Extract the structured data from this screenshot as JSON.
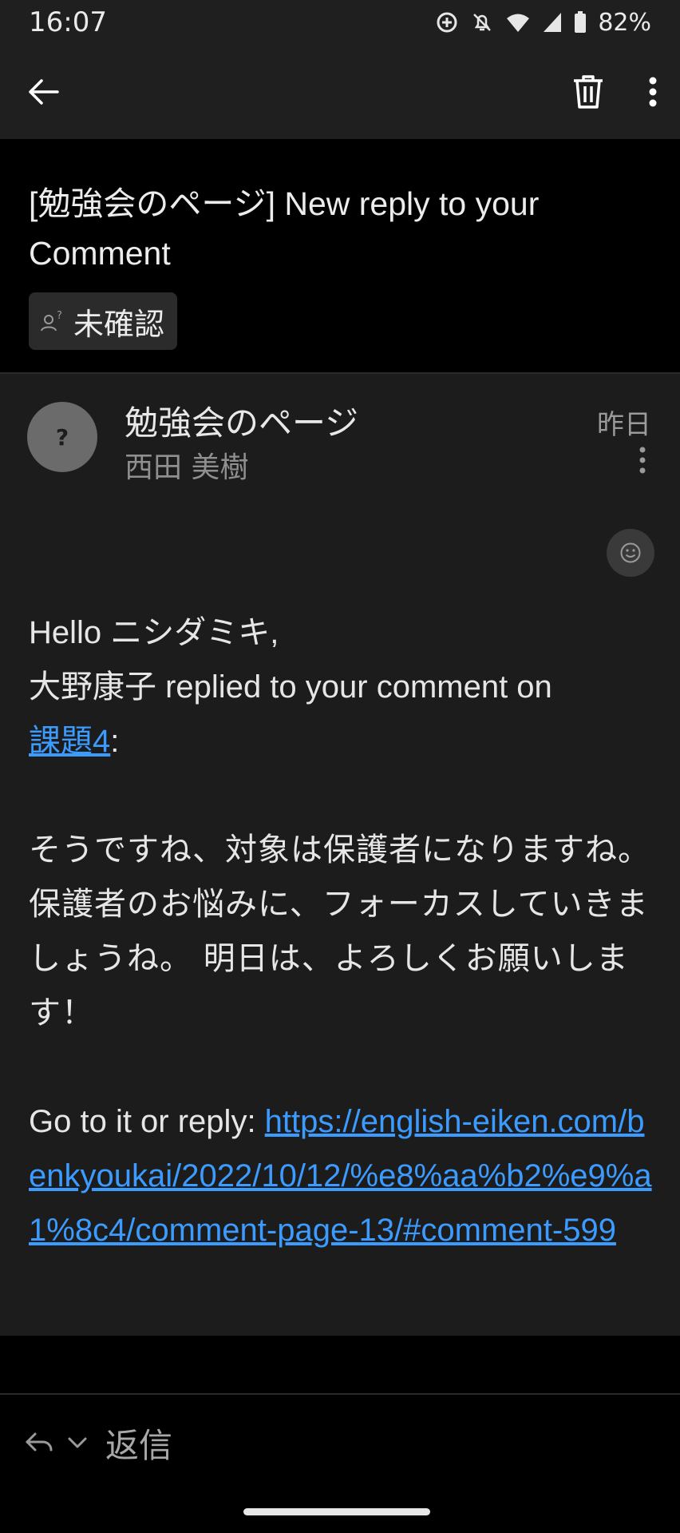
{
  "status_bar": {
    "time": "16:07",
    "battery_percent": "82%",
    "icons": [
      "data-saver-icon",
      "notifications-off-icon",
      "wifi-icon",
      "cell-signal-icon",
      "battery-icon"
    ]
  },
  "app_bar": {
    "back_icon": "arrow-left-icon",
    "delete_icon": "trash-icon",
    "more_icon": "more-vert-icon"
  },
  "email": {
    "subject": "[勉強会のページ] New reply to your Comment",
    "label": "未確認",
    "label_icon": "unknown-person-icon",
    "sender_name": "勉強会のページ",
    "recipient": "西田 美樹",
    "date": "昨日",
    "avatar_text": "?",
    "body": {
      "greeting": "Hello ニシダミキ,",
      "replied_line": "大野康子 replied to your comment on",
      "post_link": "課題4",
      "post_suffix": ":",
      "comment_text": "そうですね、対象は保護者になりますね。保護者のお悩みに、フォーカスしていきましょうね。 明日は、よろしくお願いします！",
      "goto_prefix": "Go to it or reply: ",
      "goto_link": "https://english-eiken.com/benkyoukai/2022/10/12/%e8%aa%b2%e9%a1%8c4/comment-page-13/#comment-599"
    }
  },
  "reply_bar": {
    "reply_label": "返信",
    "reply_icon": "reply-icon",
    "dropdown_icon": "chevron-down-icon"
  },
  "colors": {
    "background": "#000000",
    "message_background": "#1c1c1c",
    "link": "#3b9bff",
    "app_bar": "#1f1f1f"
  }
}
